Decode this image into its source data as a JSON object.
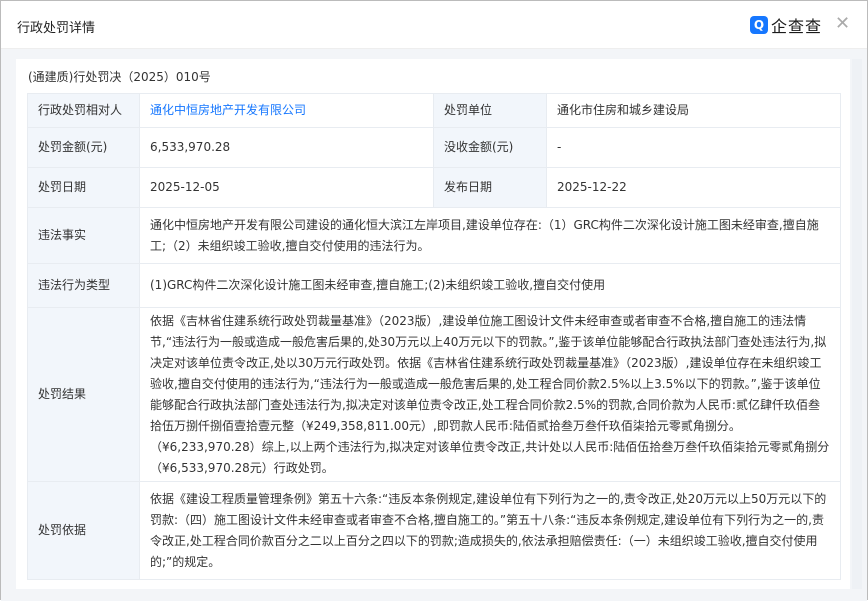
{
  "header": {
    "title": "行政处罚详情",
    "logo": "企查查",
    "close_icon": "close-icon"
  },
  "doc_number": "(通建质)行处罚决（2025）010号",
  "rows": {
    "party_label": "行政处罚相对人",
    "party_value": "通化中恒房地产开发有限公司",
    "authority_label": "处罚单位",
    "authority_value": "通化市住房和城乡建设局",
    "amount_label": "处罚金额(元)",
    "amount_value": "6,533,970.28",
    "confiscated_label": "没收金额(元)",
    "confiscated_value": "-",
    "date_label": "处罚日期",
    "date_value": "2025-12-05",
    "publish_label": "发布日期",
    "publish_value": "2025-12-22",
    "facts_label": "违法事实",
    "facts_value": "通化中恒房地产开发有限公司建设的通化恒大滨江左岸项目,建设单位存在:（1）GRC构件二次深化设计施工图未经审查,擅自施工;（2）未组织竣工验收,擅自交付使用的违法行为。",
    "type_label": "违法行为类型",
    "type_value": "(1)GRC构件二次深化设计施工图未经审查,擅自施工;(2)未组织竣工验收,擅自交付使用",
    "result_label": "处罚结果",
    "result_value": "依据《吉林省住建系统行政处罚裁量基准》（2023版）,建设单位施工图设计文件未经审查或者审查不合格,擅自施工的违法情节,“违法行为一般或造成一般危害后果的,处30万元以上40万元以下的罚款。”,鉴于该单位能够配合行政执法部门查处违法行为,拟决定对该单位责令改正,处以30万元行政处罚。依据《吉林省住建系统行政处罚裁量基准》（2023版）,建设单位存在未组织竣工验收,擅自交付使用的违法行为,“违法行为一般或造成一般危害后果的,处工程合同价款2.5%以上3.5%以下的罚款。”,鉴于该单位能够配合行政执法部门查处违法行为,拟决定对该单位责令改正,处工程合同价款2.5%的罚款,合同价款为人民币:贰亿肆仟玖佰叁拾伍万捌仟捌佰壹拾壹元整（¥249,358,811.00元）,即罚款人民币:陆佰贰拾叁万叁仟玖佰柒拾元零贰角捌分。（¥6,233,970.28）综上,以上两个违法行为,拟决定对该单位责令改正,共计处以人民币:陆佰伍拾叁万叁仟玖佰柒拾元零贰角捌分（¥6,533,970.28元）行政处罚。",
    "basis_label": "处罚依据",
    "basis_value": "依据《建设工程质量管理条例》第五十六条:“违反本条例规定,建设单位有下列行为之一的,责令改正,处20万元以上50万元以下的罚款:（四）施工图设计文件未经审查或者审查不合格,擅自施工的。”第五十八条:“违反本条例规定,建设单位有下列行为之一的,责令改正,处工程合同价款百分之二以上百分之四以下的罚款;造成损失的,依法承担赔偿责任:（一）未组织竣工验收,擅自交付使用的;”的规定。"
  }
}
